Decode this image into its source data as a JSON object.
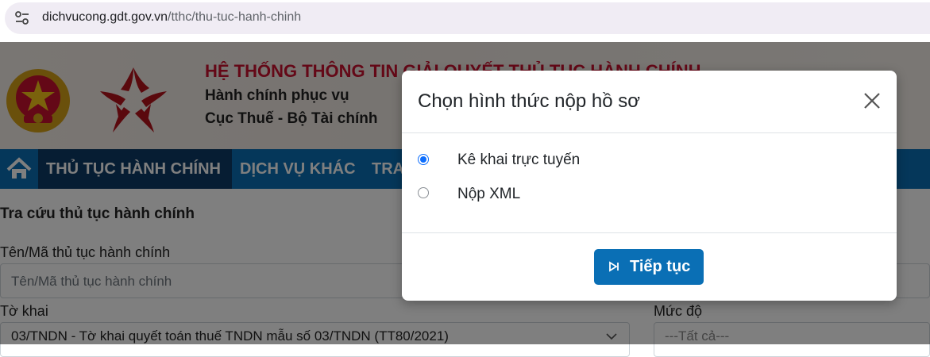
{
  "browser": {
    "url_host": "dichvucong.gdt.gov.vn",
    "url_path": "/tthc/thu-tuc-hanh-chinh"
  },
  "header": {
    "title": "HỆ THỐNG THÔNG TIN GIẢI QUYẾT THỦ TỤC HÀNH CHÍNH",
    "subtitle1": "Hành chính phục vụ",
    "subtitle2": "Cục Thuế - Bộ Tài chính"
  },
  "nav": {
    "items": [
      "THỦ TỤC HÀNH CHÍNH",
      "DỊCH VỤ KHÁC",
      "TRA"
    ]
  },
  "form": {
    "section_title": "Tra cứu thủ tục hành chính",
    "name_label": "Tên/Mã thủ tục hành chính",
    "name_placeholder": "Tên/Mã thủ tục hành chính",
    "declaration_label": "Tờ khai",
    "declaration_value": "03/TNDN - Tờ khai quyết toán thuế TNDN mẫu số 03/TNDN (TT80/2021)",
    "level_label": "Mức độ",
    "level_value": "---Tất cả---"
  },
  "modal": {
    "title": "Chọn hình thức nộp hồ sơ",
    "options": [
      {
        "label": "Kê khai trực tuyến",
        "checked": true
      },
      {
        "label": "Nộp XML",
        "checked": false
      }
    ],
    "continue_label": "Tiếp tục"
  },
  "colors": {
    "nav_bg": "#0a6fb5",
    "nav_active": "#0c3a66",
    "header_title": "#c8102e",
    "radio_checked": "#0d6efd",
    "button_bg": "#0a6fb5"
  }
}
